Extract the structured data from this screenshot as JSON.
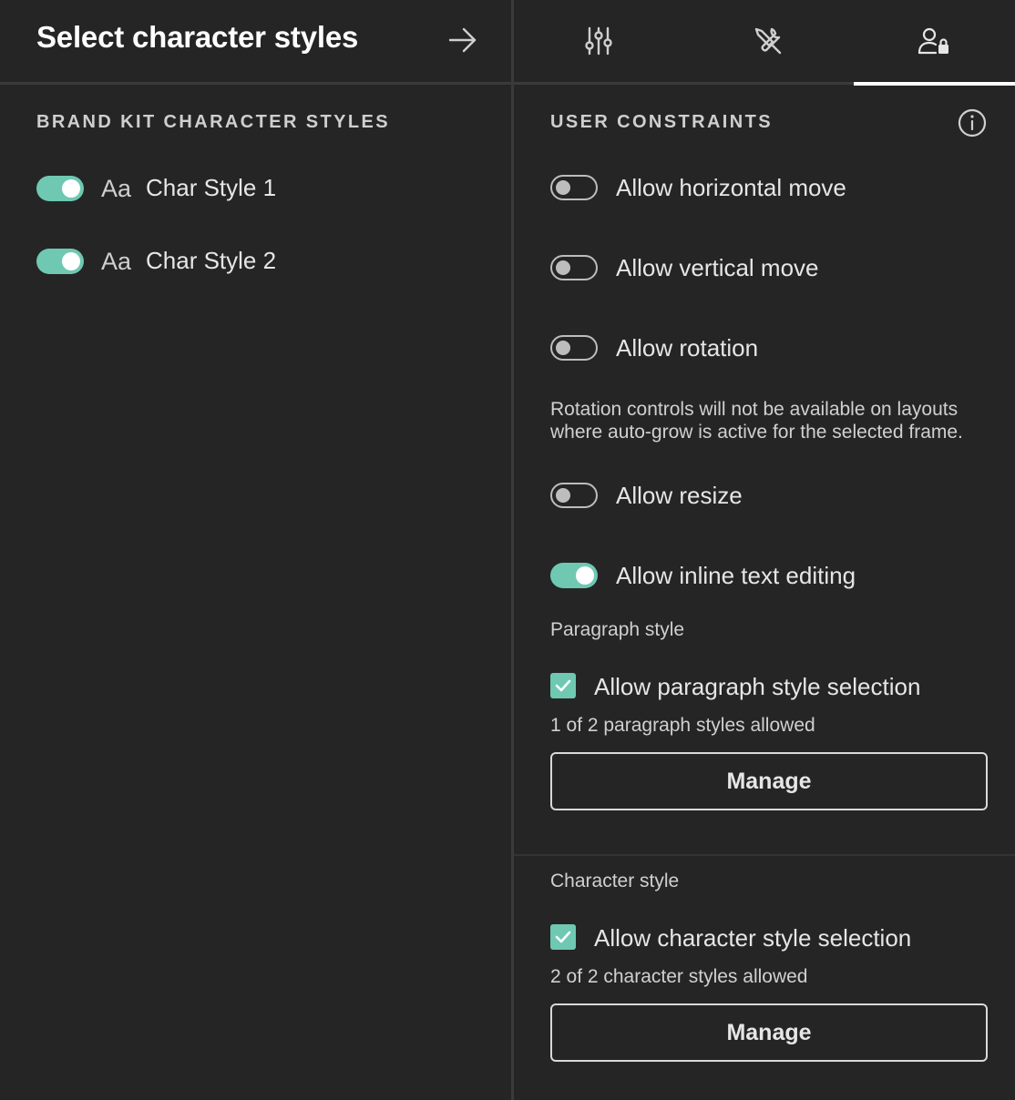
{
  "left": {
    "title": "Select character styles",
    "section_title": "BRAND KIT CHARACTER STYLES",
    "styles": [
      {
        "icon_text": "Aa",
        "label": "Char Style 1",
        "enabled": true
      },
      {
        "icon_text": "Aa",
        "label": "Char Style 2",
        "enabled": true
      }
    ]
  },
  "tabs": [
    {
      "icon": "sliders-icon",
      "active": false
    },
    {
      "icon": "tools-icon",
      "active": false
    },
    {
      "icon": "user-lock-icon",
      "active": true
    }
  ],
  "right": {
    "section_title": "USER CONSTRAINTS",
    "constraints": [
      {
        "label": "Allow horizontal move",
        "enabled": false
      },
      {
        "label": "Allow vertical move",
        "enabled": false
      },
      {
        "label": "Allow rotation",
        "enabled": false
      },
      {
        "label": "Allow resize",
        "enabled": false
      },
      {
        "label": "Allow inline text editing",
        "enabled": true
      }
    ],
    "rotation_note": "Rotation controls will not be available on layouts where auto-grow is active for the selected frame.",
    "paragraph": {
      "title": "Paragraph style",
      "check_label": "Allow paragraph style selection",
      "checked": true,
      "count": "1 of 2 paragraph styles allowed",
      "button": "Manage"
    },
    "character": {
      "title": "Character style",
      "check_label": "Allow character style selection",
      "checked": true,
      "count": "2 of 2 character styles allowed",
      "button": "Manage"
    }
  },
  "colors": {
    "background": "#252525",
    "accent": "#6fc8b2",
    "divider": "#3a3a3a",
    "text": "#e6e6e6"
  }
}
